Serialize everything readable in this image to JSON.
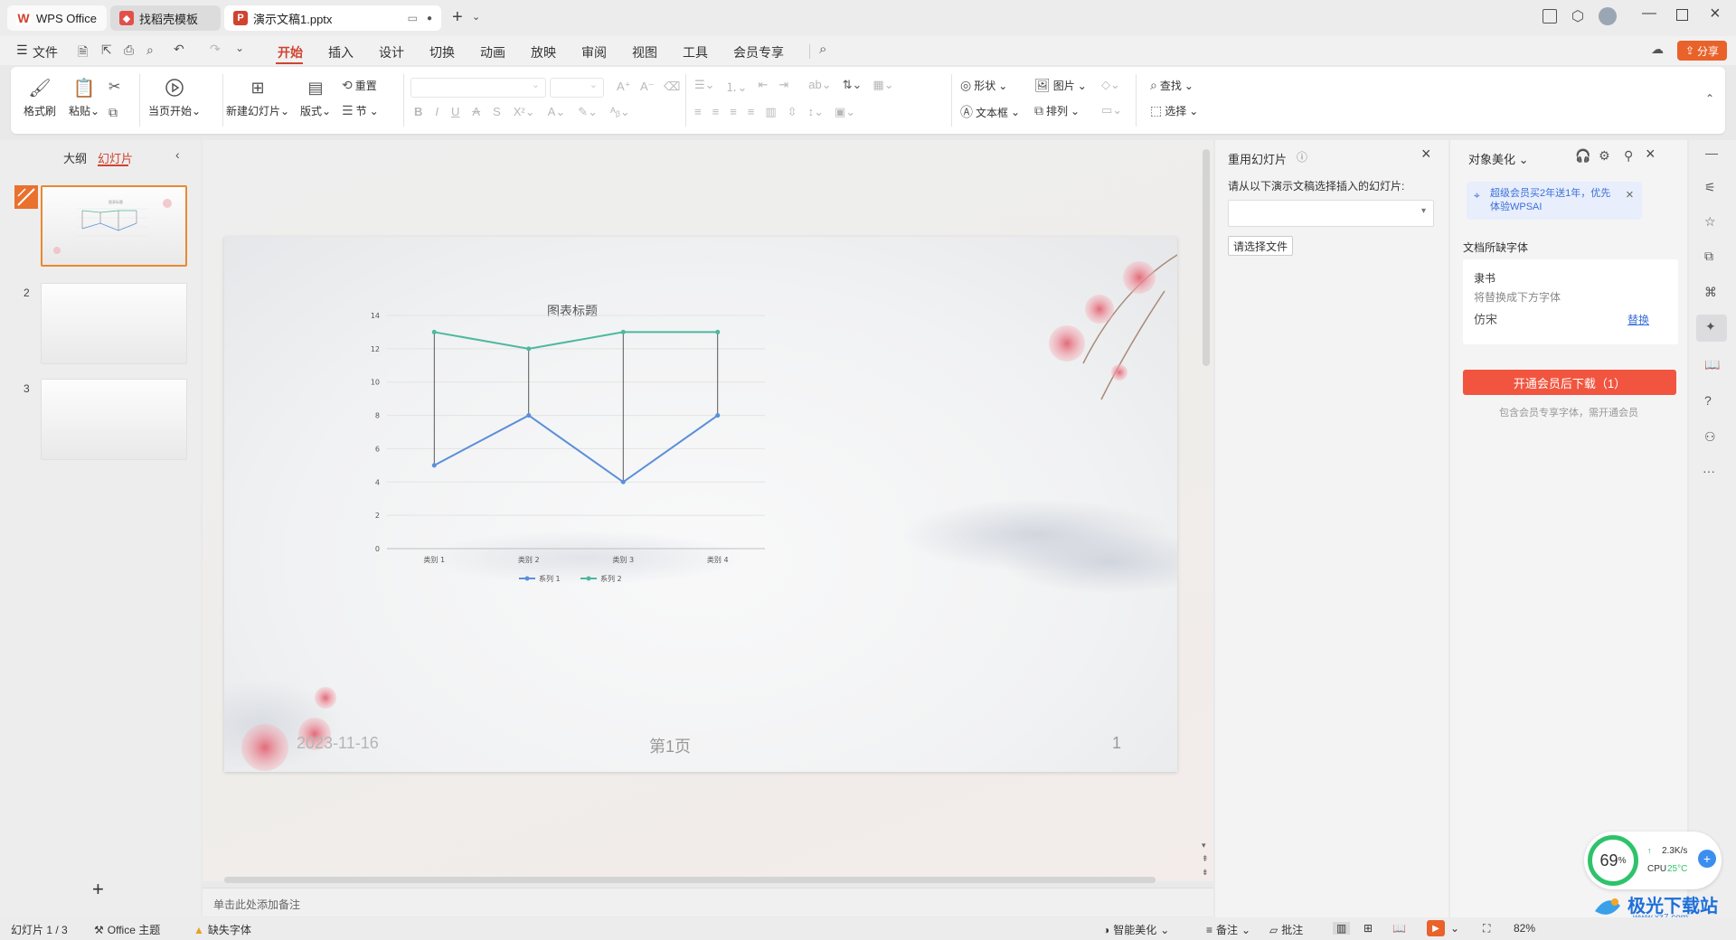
{
  "titlebar": {
    "tabs": [
      {
        "label": "WPS Office",
        "icon": "wps-logo-icon"
      },
      {
        "label": "找稻壳模板",
        "icon": "docer-icon"
      },
      {
        "label": "演示文稿1.pptx",
        "icon": "ppt-icon"
      }
    ]
  },
  "menubar": {
    "file": "文件",
    "items": [
      "开始",
      "插入",
      "设计",
      "切换",
      "动画",
      "放映",
      "审阅",
      "视图",
      "工具",
      "会员专享"
    ],
    "active": "开始",
    "share": "分享"
  },
  "ribbon": {
    "format_painter": "格式刷",
    "paste": "粘贴",
    "from_current": "当页开始",
    "new_slide": "新建幻灯片",
    "layout": "版式",
    "reset": "重置",
    "section": "节",
    "shape": "形状",
    "picture": "图片",
    "textbox": "文本框",
    "arrange": "排列",
    "find": "查找",
    "select": "选择"
  },
  "leftpanel": {
    "tab_outline": "大纲",
    "tab_slides": "幻灯片",
    "slide_numbers": [
      "2",
      "3"
    ]
  },
  "slide": {
    "date": "2023-11-16",
    "page_label": "第1页",
    "page_number": "1"
  },
  "chart_data": {
    "type": "line",
    "title": "图表标题",
    "categories": [
      "类别 1",
      "类别 2",
      "类别 3",
      "类别 4"
    ],
    "ylim": [
      0,
      14
    ],
    "yticks": [
      "0",
      "2",
      "4",
      "6",
      "8",
      "10",
      "12",
      "14"
    ],
    "series": [
      {
        "name": "系列 1",
        "values": [
          5,
          8,
          4,
          8
        ],
        "color": "#5b8fd9"
      },
      {
        "name": "系列 2",
        "values": [
          13,
          12,
          13,
          13
        ],
        "color": "#4db8a0"
      }
    ],
    "legend_labels": [
      "系列 1",
      "系列 2"
    ],
    "legend_position": "bottom",
    "high_low_lines": true,
    "grid": true
  },
  "notes_placeholder": "单击此处添加备注",
  "reuse": {
    "title": "重用幻灯片",
    "prompt": "请从以下演示文稿选择插入的幻灯片:",
    "choose_button": "请选择文件"
  },
  "beauty": {
    "title": "对象美化",
    "promo": "超级会员买2年送1年，优先体验WPSAI",
    "missing_fonts_title": "文档所缺字体",
    "font_name": "隶书",
    "replace_hint": "将替换成下方字体",
    "replacement_font": "仿宋",
    "replace_link": "替换",
    "download_button": "开通会员后下载（1）",
    "footnote": "包含会员专享字体，需开通会员"
  },
  "statusbar": {
    "slide_info": "幻灯片 1 / 3",
    "theme": "Office 主题",
    "missing_font": "缺失字体",
    "smart_beautify": "智能美化",
    "notes": "备注",
    "comments": "批注",
    "zoom": "82%"
  },
  "widget": {
    "percent": "69",
    "unit": "%",
    "speed": "2.3K/s",
    "cpu_label": "CPU",
    "cpu_temp": "25°C"
  },
  "watermark": {
    "site": "极光下载站",
    "url": "www.xz7.com"
  },
  "colors": {
    "accent": "#d0432f",
    "download_button": "#f1553f",
    "arrow": "#c8252c"
  }
}
